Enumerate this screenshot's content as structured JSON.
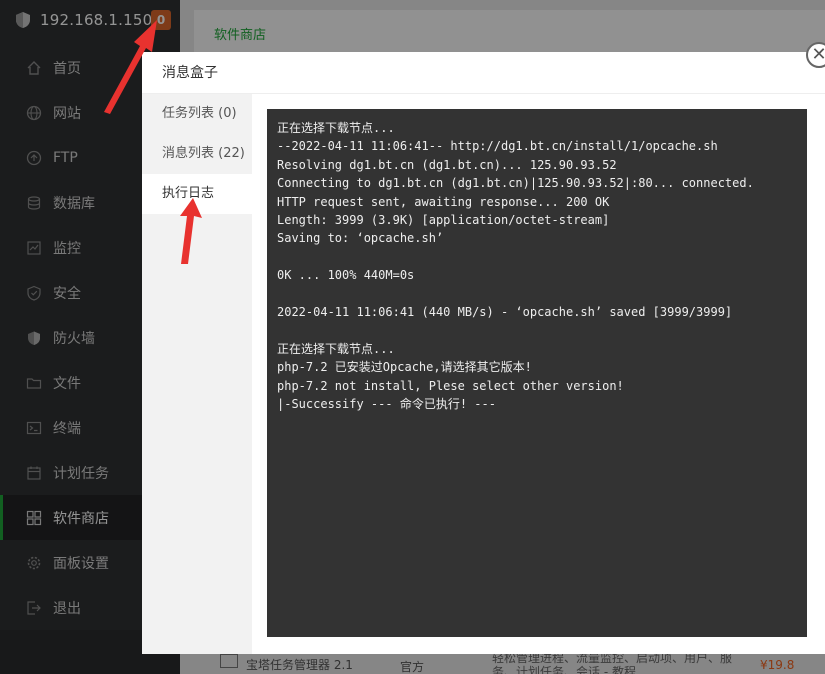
{
  "sidebar": {
    "ip": "192.168.1.150",
    "badge": "0",
    "items": [
      {
        "label": "首页",
        "icon": "home-icon"
      },
      {
        "label": "网站",
        "icon": "globe-icon"
      },
      {
        "label": "FTP",
        "icon": "ftp-icon"
      },
      {
        "label": "数据库",
        "icon": "database-icon"
      },
      {
        "label": "监控",
        "icon": "monitor-icon"
      },
      {
        "label": "安全",
        "icon": "security-icon"
      },
      {
        "label": "防火墙",
        "icon": "firewall-icon"
      },
      {
        "label": "文件",
        "icon": "folder-icon"
      },
      {
        "label": "终端",
        "icon": "terminal-icon"
      },
      {
        "label": "计划任务",
        "icon": "calendar-icon"
      },
      {
        "label": "软件商店",
        "icon": "grid-icon",
        "active": true
      },
      {
        "label": "面板设置",
        "icon": "gear-icon"
      },
      {
        "label": "退出",
        "icon": "logout-icon"
      }
    ]
  },
  "main": {
    "tab_label": "软件商店",
    "row": {
      "name": "宝塔任务管理器 2.1",
      "type": "官方",
      "desc_line1": "轻松管理进程、流量监控、启动项、用户、服",
      "desc_line2": "务、计划任务、会话 - 教程",
      "price": "¥19.8"
    }
  },
  "modal": {
    "title": "消息盒子",
    "tabs": [
      {
        "label": "任务列表 (0)"
      },
      {
        "label": "消息列表 (22)"
      },
      {
        "label": "执行日志",
        "active": true
      }
    ],
    "log_lines": [
      "正在选择下载节点...",
      "--2022-04-11 11:06:41-- http://dg1.bt.cn/install/1/opcache.sh",
      "Resolving dg1.bt.cn (dg1.bt.cn)... 125.90.93.52",
      "Connecting to dg1.bt.cn (dg1.bt.cn)|125.90.93.52|:80... connected.",
      "HTTP request sent, awaiting response... 200 OK",
      "Length: 3999 (3.9K) [application/octet-stream]",
      "Saving to: ‘opcache.sh’",
      "",
      "0K ... 100% 440M=0s",
      "",
      "2022-04-11 11:06:41 (440 MB/s) - ‘opcache.sh’ saved [3999/3999]",
      "",
      "正在选择下载节点...",
      "php-7.2 已安装过Opcache,请选择其它版本!",
      "php-7.2 not install, Plese select other version!",
      "|-Successify --- 命令已执行! ---"
    ]
  },
  "colors": {
    "accent": "#20a53a",
    "sidebar_bg": "#2f3132",
    "badge": "#d9662b",
    "terminal_bg": "#333333",
    "arrow": "#e8322f"
  }
}
